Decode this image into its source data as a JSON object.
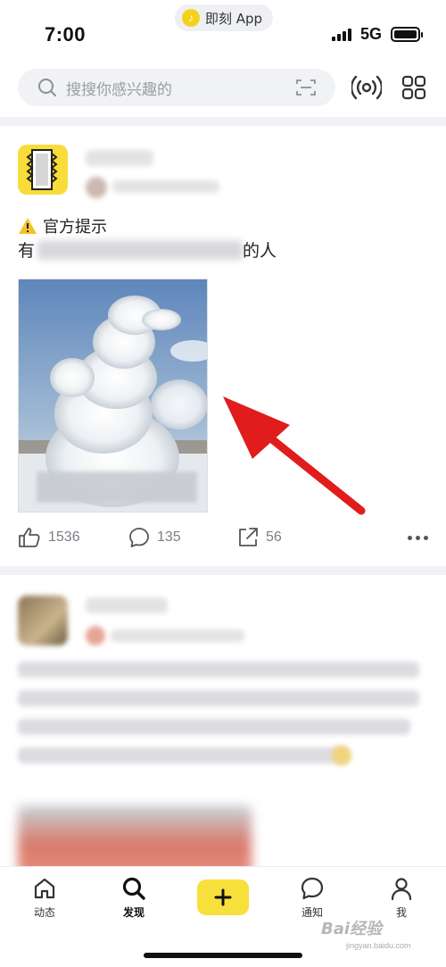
{
  "status_bar": {
    "time": "7:00",
    "app_pill_label": "即刻 App",
    "network": "5G"
  },
  "search": {
    "placeholder": "搜搜你感兴趣的"
  },
  "feed": {
    "post1": {
      "notice_title": "官方提示",
      "content_prefix": "有",
      "content_suffix": "的人",
      "like_count": "1536",
      "comment_count": "135",
      "share_count": "56"
    }
  },
  "tab_bar": {
    "tabs": [
      {
        "label": "动态"
      },
      {
        "label": "发现"
      },
      {
        "label": "通知"
      },
      {
        "label": "我"
      }
    ],
    "watermark": "Bai经验",
    "watermark_sub": "jingyan.baidu.com"
  },
  "colors": {
    "accent_yellow": "#f8e03c",
    "arrow_red": "#e01c1c",
    "divider": "#f0f2f5"
  }
}
